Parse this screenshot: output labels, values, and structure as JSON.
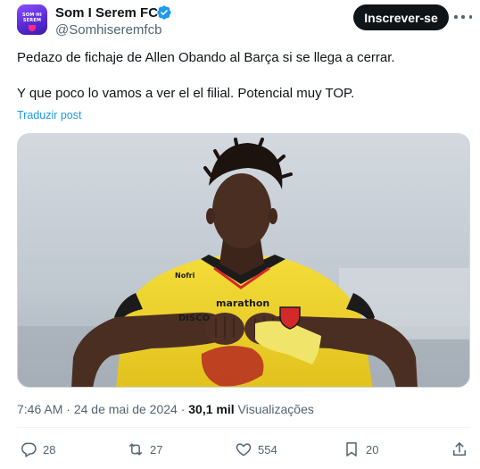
{
  "account": {
    "display_name": "Som I Serem FCB",
    "handle": "@Somhiseremfcb",
    "avatar_text_line1": "SOM·HI",
    "avatar_text_line2": "SEREM",
    "verified_icon": "verified-badge-icon"
  },
  "header": {
    "follow_label": "Inscrever-se",
    "more_icon": "more-dots-icon"
  },
  "tweet": {
    "text_line1": "Pedazo de fichaje de Allen Obando al Barça si se llega a cerrar.",
    "text_line2": "Y que poco lo vamos a ver el el filial. Potencial muy TOP.",
    "translate_label": "Traduzir post"
  },
  "media": {
    "jersey_text_1": "marathon",
    "jersey_text_2": "DISCO",
    "jersey_text_3": "Nofri",
    "colors": {
      "jersey": "#f2d72c",
      "skin": "#4a2e22",
      "bandage": "#f1e46a"
    }
  },
  "meta": {
    "time": "7:46 AM",
    "separator": "·",
    "date": "24 de mai de 2024",
    "views_count": "30,1 mil",
    "views_label": "Visualizações"
  },
  "actions": {
    "reply_count": "28",
    "retweet_count": "27",
    "like_count": "554",
    "bookmark_count": "20"
  },
  "colors": {
    "accent": "#1d9bf0",
    "text": "#0f1419",
    "muted": "#536471"
  }
}
